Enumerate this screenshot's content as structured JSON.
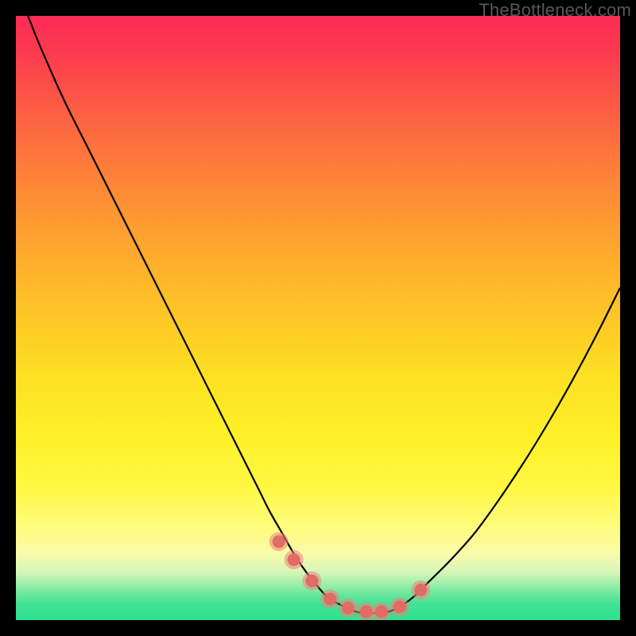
{
  "watermark": "TheBottleneck.com",
  "chart_data": {
    "type": "line",
    "title": "",
    "xlabel": "",
    "ylabel": "",
    "xlim": [
      0,
      100
    ],
    "ylim": [
      0,
      100
    ],
    "series": [
      {
        "name": "curve",
        "x": [
          2,
          4,
          8,
          12,
          16,
          20,
          24,
          28,
          32,
          36,
          40,
          42,
          44,
          46,
          48,
          50,
          52,
          56,
          58,
          60,
          62,
          64,
          66,
          68,
          72,
          76,
          80,
          84,
          88,
          92,
          96,
          100
        ],
        "values": [
          100,
          95,
          86,
          78,
          70,
          62,
          54,
          46,
          38,
          30,
          22,
          18,
          14.5,
          11,
          8,
          5.5,
          3.5,
          1.5,
          1.2,
          1.2,
          1.5,
          2.5,
          4,
          6,
          10,
          14.5,
          20,
          26,
          32.5,
          39.5,
          47,
          55
        ]
      }
    ],
    "points": {
      "name": "highlighted-points",
      "x": [
        43.5,
        46,
        49,
        52,
        55,
        58,
        60.5,
        63.5,
        67
      ],
      "values": [
        13,
        10,
        6.5,
        3.5,
        2,
        1.4,
        1.4,
        2.2,
        5
      ]
    },
    "gradient_stops": [
      {
        "pos": 0,
        "color": "#FC2B54"
      },
      {
        "pos": 0.5,
        "color": "#FEE024"
      },
      {
        "pos": 0.97,
        "color": "#2FE090"
      }
    ]
  }
}
